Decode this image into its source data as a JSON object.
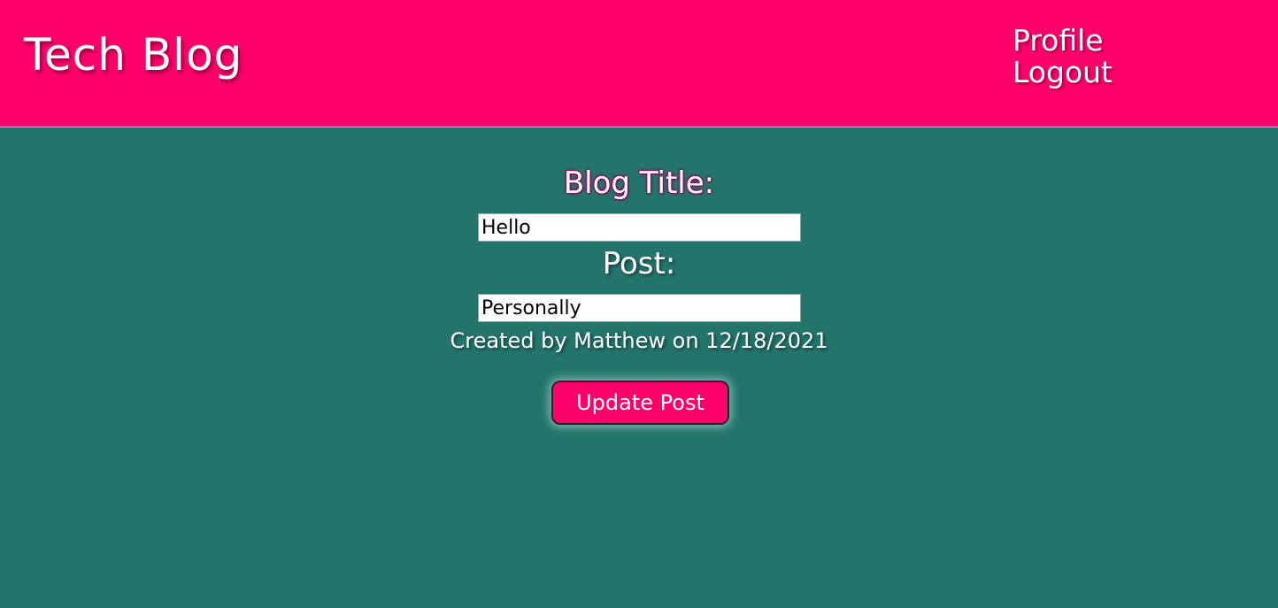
{
  "header": {
    "site_title": "Tech Blog",
    "nav": {
      "profile_label": "Profile",
      "logout_label": "Logout"
    }
  },
  "form": {
    "title_label": "Blog Title:",
    "title_value": "Hello",
    "post_label": "Post:",
    "post_value": "Personally",
    "meta_text": "Created by Matthew on 12/18/2021",
    "update_button_label": "Update Post"
  },
  "colors": {
    "header_bg": "#ff006b",
    "page_bg": "#23746b",
    "button_bg": "#ff006b",
    "text": "#ffffff"
  }
}
